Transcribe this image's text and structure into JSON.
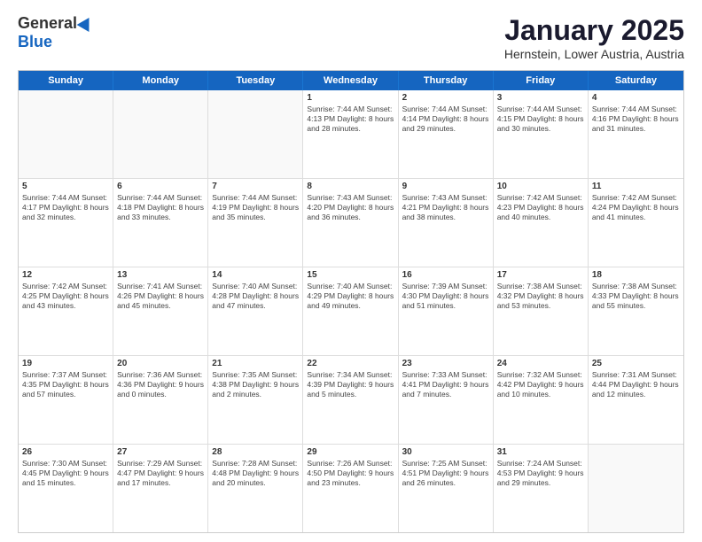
{
  "logo": {
    "general": "General",
    "blue": "Blue"
  },
  "title": "January 2025",
  "location": "Hernstein, Lower Austria, Austria",
  "weekdays": [
    "Sunday",
    "Monday",
    "Tuesday",
    "Wednesday",
    "Thursday",
    "Friday",
    "Saturday"
  ],
  "rows": [
    [
      {
        "day": "",
        "text": ""
      },
      {
        "day": "",
        "text": ""
      },
      {
        "day": "",
        "text": ""
      },
      {
        "day": "1",
        "text": "Sunrise: 7:44 AM\nSunset: 4:13 PM\nDaylight: 8 hours and 28 minutes."
      },
      {
        "day": "2",
        "text": "Sunrise: 7:44 AM\nSunset: 4:14 PM\nDaylight: 8 hours and 29 minutes."
      },
      {
        "day": "3",
        "text": "Sunrise: 7:44 AM\nSunset: 4:15 PM\nDaylight: 8 hours and 30 minutes."
      },
      {
        "day": "4",
        "text": "Sunrise: 7:44 AM\nSunset: 4:16 PM\nDaylight: 8 hours and 31 minutes."
      }
    ],
    [
      {
        "day": "5",
        "text": "Sunrise: 7:44 AM\nSunset: 4:17 PM\nDaylight: 8 hours and 32 minutes."
      },
      {
        "day": "6",
        "text": "Sunrise: 7:44 AM\nSunset: 4:18 PM\nDaylight: 8 hours and 33 minutes."
      },
      {
        "day": "7",
        "text": "Sunrise: 7:44 AM\nSunset: 4:19 PM\nDaylight: 8 hours and 35 minutes."
      },
      {
        "day": "8",
        "text": "Sunrise: 7:43 AM\nSunset: 4:20 PM\nDaylight: 8 hours and 36 minutes."
      },
      {
        "day": "9",
        "text": "Sunrise: 7:43 AM\nSunset: 4:21 PM\nDaylight: 8 hours and 38 minutes."
      },
      {
        "day": "10",
        "text": "Sunrise: 7:42 AM\nSunset: 4:23 PM\nDaylight: 8 hours and 40 minutes."
      },
      {
        "day": "11",
        "text": "Sunrise: 7:42 AM\nSunset: 4:24 PM\nDaylight: 8 hours and 41 minutes."
      }
    ],
    [
      {
        "day": "12",
        "text": "Sunrise: 7:42 AM\nSunset: 4:25 PM\nDaylight: 8 hours and 43 minutes."
      },
      {
        "day": "13",
        "text": "Sunrise: 7:41 AM\nSunset: 4:26 PM\nDaylight: 8 hours and 45 minutes."
      },
      {
        "day": "14",
        "text": "Sunrise: 7:40 AM\nSunset: 4:28 PM\nDaylight: 8 hours and 47 minutes."
      },
      {
        "day": "15",
        "text": "Sunrise: 7:40 AM\nSunset: 4:29 PM\nDaylight: 8 hours and 49 minutes."
      },
      {
        "day": "16",
        "text": "Sunrise: 7:39 AM\nSunset: 4:30 PM\nDaylight: 8 hours and 51 minutes."
      },
      {
        "day": "17",
        "text": "Sunrise: 7:38 AM\nSunset: 4:32 PM\nDaylight: 8 hours and 53 minutes."
      },
      {
        "day": "18",
        "text": "Sunrise: 7:38 AM\nSunset: 4:33 PM\nDaylight: 8 hours and 55 minutes."
      }
    ],
    [
      {
        "day": "19",
        "text": "Sunrise: 7:37 AM\nSunset: 4:35 PM\nDaylight: 8 hours and 57 minutes."
      },
      {
        "day": "20",
        "text": "Sunrise: 7:36 AM\nSunset: 4:36 PM\nDaylight: 9 hours and 0 minutes."
      },
      {
        "day": "21",
        "text": "Sunrise: 7:35 AM\nSunset: 4:38 PM\nDaylight: 9 hours and 2 minutes."
      },
      {
        "day": "22",
        "text": "Sunrise: 7:34 AM\nSunset: 4:39 PM\nDaylight: 9 hours and 5 minutes."
      },
      {
        "day": "23",
        "text": "Sunrise: 7:33 AM\nSunset: 4:41 PM\nDaylight: 9 hours and 7 minutes."
      },
      {
        "day": "24",
        "text": "Sunrise: 7:32 AM\nSunset: 4:42 PM\nDaylight: 9 hours and 10 minutes."
      },
      {
        "day": "25",
        "text": "Sunrise: 7:31 AM\nSunset: 4:44 PM\nDaylight: 9 hours and 12 minutes."
      }
    ],
    [
      {
        "day": "26",
        "text": "Sunrise: 7:30 AM\nSunset: 4:45 PM\nDaylight: 9 hours and 15 minutes."
      },
      {
        "day": "27",
        "text": "Sunrise: 7:29 AM\nSunset: 4:47 PM\nDaylight: 9 hours and 17 minutes."
      },
      {
        "day": "28",
        "text": "Sunrise: 7:28 AM\nSunset: 4:48 PM\nDaylight: 9 hours and 20 minutes."
      },
      {
        "day": "29",
        "text": "Sunrise: 7:26 AM\nSunset: 4:50 PM\nDaylight: 9 hours and 23 minutes."
      },
      {
        "day": "30",
        "text": "Sunrise: 7:25 AM\nSunset: 4:51 PM\nDaylight: 9 hours and 26 minutes."
      },
      {
        "day": "31",
        "text": "Sunrise: 7:24 AM\nSunset: 4:53 PM\nDaylight: 9 hours and 29 minutes."
      },
      {
        "day": "",
        "text": ""
      }
    ]
  ]
}
